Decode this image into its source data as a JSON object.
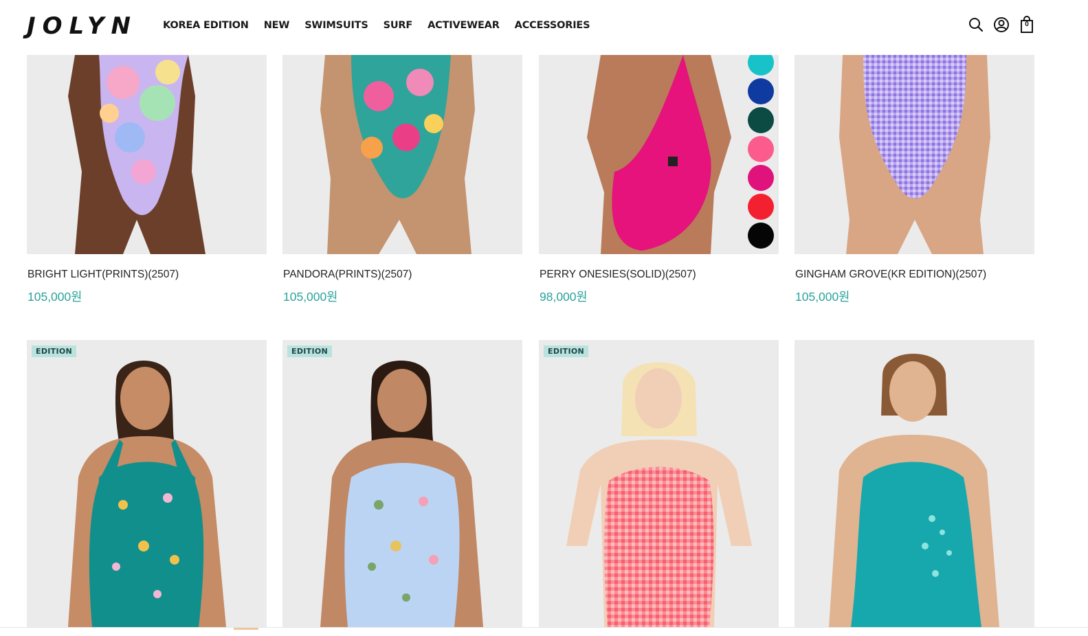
{
  "brand": {
    "logo": "JOLYN"
  },
  "nav": {
    "items": [
      {
        "label": "KOREA EDITION"
      },
      {
        "label": "NEW"
      },
      {
        "label": "SWIMSUITS"
      },
      {
        "label": "SURF"
      },
      {
        "label": "ACTIVEWEAR"
      },
      {
        "label": "ACCESSORIES"
      }
    ]
  },
  "header_icons": {
    "search": "search-icon",
    "account": "user-circle-icon",
    "cart": "shopping-bag-icon",
    "cart_count": "0"
  },
  "products_row1": [
    {
      "name": "BRIGHT LIGHT(PRINTS)(2507)",
      "price": "105,000원"
    },
    {
      "name": "PANDORA(PRINTS)(2507)",
      "price": "105,000원"
    },
    {
      "name": "PERRY ONESIES(SOLID)(2507)",
      "price": "98,000원",
      "swatches": [
        "#17c3c9",
        "#0f3aa0",
        "#0c4a44",
        "#fb5b8d",
        "#e0137d",
        "#f3212f",
        "#050505"
      ]
    },
    {
      "name": "GINGHAM GROVE(KR EDITION)(2507)",
      "price": "105,000원"
    }
  ],
  "products_row2": [
    {
      "badge": "EDITION",
      "suit_color": "#118f8c",
      "pattern": "kangaroo-print"
    },
    {
      "badge": "EDITION",
      "suit_color": "#bcd4f3",
      "pattern": "sea-turtle-print"
    },
    {
      "badge": "EDITION",
      "suit_color": "#fb7b88",
      "pattern": "gingham"
    },
    {
      "suit_color": "#17a8ad",
      "pattern": "foil-spots"
    }
  ]
}
